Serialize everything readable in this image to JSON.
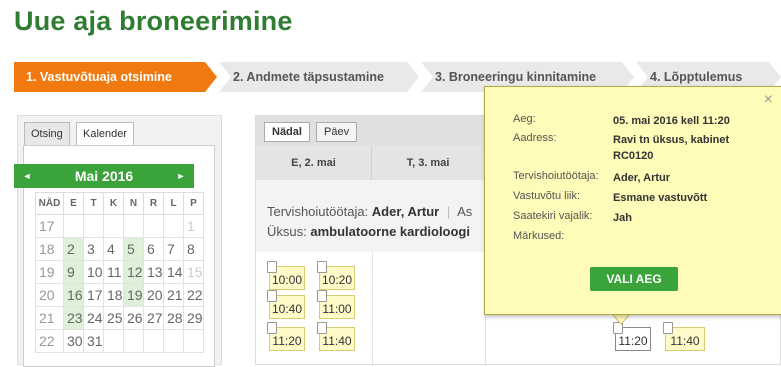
{
  "page": {
    "title": "Uue aja broneerimine"
  },
  "steps": [
    {
      "label": "1. Vastuvõtuaja otsimine",
      "active": true
    },
    {
      "label": "2. Andmete täpsustamine"
    },
    {
      "label": "3. Broneeringu kinnitamine"
    },
    {
      "label": "4. Lõpptulemus"
    }
  ],
  "left_tabs": {
    "search": "Otsing",
    "calendar": "Kalender"
  },
  "calendar": {
    "month": "Mai 2016",
    "prev": "◄",
    "next": "►",
    "headers": [
      "NÄD",
      "E",
      "T",
      "K",
      "N",
      "R",
      "L",
      "P"
    ],
    "rows": [
      [
        "17",
        "",
        "",
        "",
        "",
        "",
        "",
        "1"
      ],
      [
        "18",
        "2",
        "3",
        "4",
        "5",
        "6",
        "7",
        "8"
      ],
      [
        "19",
        "9",
        "10",
        "11",
        "12",
        "13",
        "14",
        "15"
      ],
      [
        "20",
        "16",
        "17",
        "18",
        "19",
        "20",
        "21",
        "22"
      ],
      [
        "21",
        "23",
        "24",
        "25",
        "26",
        "27",
        "28",
        "29"
      ],
      [
        "22",
        "30",
        "31",
        "",
        "",
        "",
        "",
        ""
      ]
    ]
  },
  "view_tabs": {
    "week": "Nädal",
    "day": "Päev"
  },
  "days": [
    "E, 2. mai",
    "T, 3. mai"
  ],
  "info": {
    "worker_label": "Tervishoiutöötaja:",
    "worker_value": "Ader, Artur",
    "extra_label": "As",
    "unit_label": "Üksus:",
    "unit_value": "ambulatoorne kardioloogi"
  },
  "slots": {
    "day1": [
      "10:00",
      "10:20",
      "10:40",
      "11:00",
      "11:20",
      "11:40"
    ],
    "day5": [
      "11:20",
      "11:40"
    ]
  },
  "popup": {
    "close": "×",
    "rows": [
      {
        "label": "Aeg:",
        "value": "05. mai 2016 kell 11:20"
      },
      {
        "label": "Aadress:",
        "value": "Ravi tn üksus, kabinet RC0120"
      },
      {
        "label": "Tervishoiutöötaja:",
        "value": "Ader, Artur"
      },
      {
        "label": "Vastuvõtu liik:",
        "value": "Esmane vastuvõtt"
      },
      {
        "label": "Saatekiri vajalik:",
        "value": "Jah"
      },
      {
        "label": "Märkused:",
        "value": ""
      }
    ],
    "button": "VALI AEG"
  }
}
